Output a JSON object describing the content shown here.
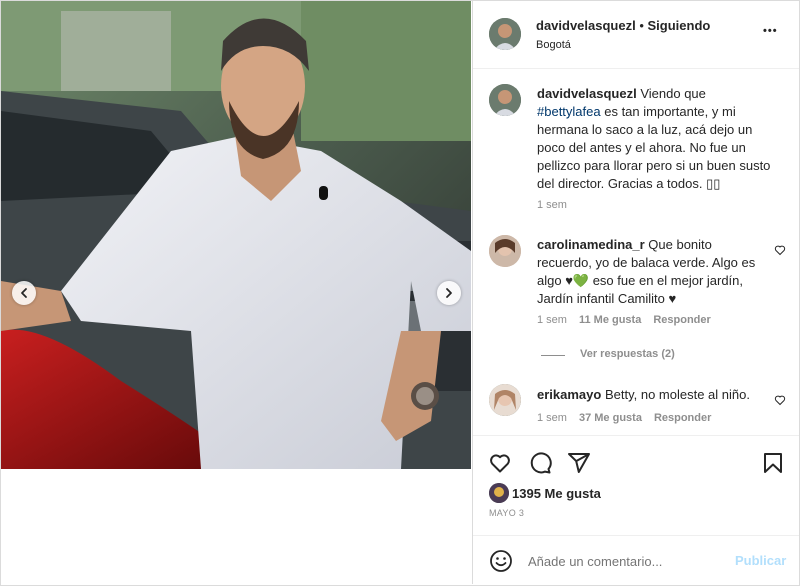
{
  "post": {
    "username": "davidvelasquezl",
    "follow_status": "Siguiendo",
    "location": "Bogotá",
    "more_label": "•••"
  },
  "caption": {
    "username": "davidvelasquezl",
    "text_before": "Viendo que ",
    "hashtag": "#bettylafea",
    "text_after": " es tan importante, y mi hermana lo saco a la luz, acá dejo un poco del antes y el ahora. No fue un pellizco para llorar pero si un buen susto del director. Gracias a todos. ▯▯",
    "time": "1 sem"
  },
  "comments": [
    {
      "username": "carolinamedina_r",
      "text": "Que bonito recuerdo, yo de balaca verde. Algo es algo ♥💚 eso fue en el mejor jardín, Jardín infantil Camilito ♥",
      "time": "1 sem",
      "likes": "11 Me gusta",
      "reply": "Responder",
      "view_replies": "Ver respuestas (2)"
    },
    {
      "username": "erikamayo",
      "text": "Betty, no moleste al niño.",
      "time": "1 sem",
      "likes": "37 Me gusta",
      "reply": "Responder"
    }
  ],
  "likes": {
    "count_label": "1395 Me gusta"
  },
  "date": "MAYO 3",
  "add_comment": {
    "placeholder": "Añade un comentario...",
    "publish": "Publicar"
  },
  "icons": {
    "header_avatar": "avatar",
    "caption_avatar": "avatar",
    "like": "heart-icon",
    "comment": "comment-icon",
    "share": "paper-plane-icon",
    "save": "bookmark-icon",
    "emoji": "smiley-icon",
    "prev": "chevron-left-icon",
    "next": "chevron-right-icon"
  },
  "colors": {
    "link": "#00376b",
    "publish_disabled": "#b2dffc",
    "muted": "#8e8e8e",
    "text": "#262626"
  }
}
